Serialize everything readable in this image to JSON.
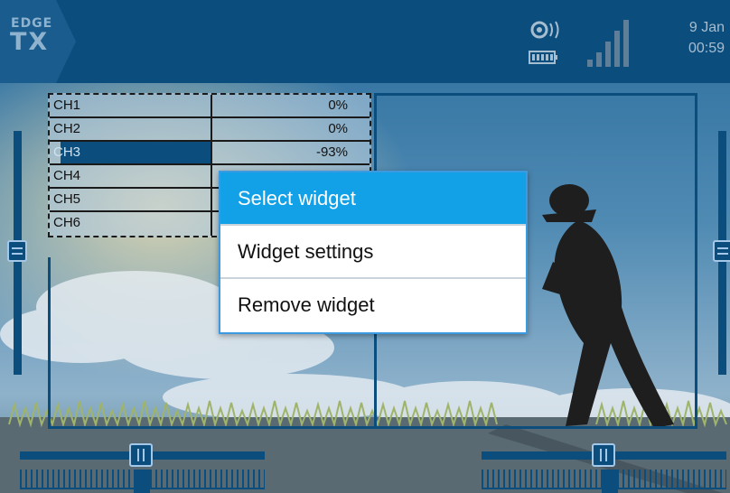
{
  "header": {
    "logo_top": "EDGE",
    "logo_bottom": "TX",
    "date": "9 Jan",
    "time": "00:59"
  },
  "channels": [
    {
      "label": "CH1",
      "value": "0%",
      "level": 0
    },
    {
      "label": "CH2",
      "value": "0%",
      "level": 0
    },
    {
      "label": "CH3",
      "value": "-93%",
      "level": -93
    },
    {
      "label": "CH4",
      "value": "",
      "level": 0
    },
    {
      "label": "CH5",
      "value": "",
      "level": 0
    },
    {
      "label": "CH6",
      "value": "",
      "level": 0
    }
  ],
  "menu": {
    "items": [
      {
        "label": "Select widget",
        "selected": true
      },
      {
        "label": "Widget settings",
        "selected": false
      },
      {
        "label": "Remove widget",
        "selected": false
      }
    ]
  },
  "icons": {
    "signal": "rssi-signal-icon",
    "battery": "battery-icon",
    "audio": "volume-icon"
  },
  "colors": {
    "accent": "#0b4d7d",
    "highlight": "#12a0e6"
  }
}
